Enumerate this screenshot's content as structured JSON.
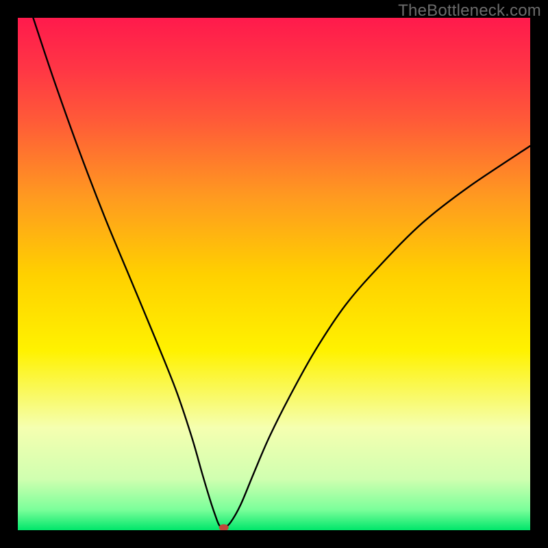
{
  "watermark": "TheBottleneck.com",
  "chart_data": {
    "type": "line",
    "title": "",
    "xlabel": "",
    "ylabel": "",
    "xlim": [
      0,
      100
    ],
    "ylim": [
      0,
      100
    ],
    "background_gradient": {
      "stops": [
        {
          "offset": 0.0,
          "color": "#ff1a4c"
        },
        {
          "offset": 0.1,
          "color": "#ff3645"
        },
        {
          "offset": 0.2,
          "color": "#ff5a38"
        },
        {
          "offset": 0.35,
          "color": "#ff9a20"
        },
        {
          "offset": 0.5,
          "color": "#ffd000"
        },
        {
          "offset": 0.65,
          "color": "#fff200"
        },
        {
          "offset": 0.8,
          "color": "#f5ffb0"
        },
        {
          "offset": 0.9,
          "color": "#d0ffb0"
        },
        {
          "offset": 0.96,
          "color": "#7bff9a"
        },
        {
          "offset": 1.0,
          "color": "#00e66a"
        }
      ]
    },
    "series": [
      {
        "name": "bottleneck-curve",
        "color": "#000000",
        "stroke_width": 2.4,
        "x": [
          3,
          7,
          12,
          17,
          22,
          27,
          31,
          34,
          36,
          37.5,
          38.5,
          39.3,
          40.2,
          41.5,
          43.5,
          46,
          49,
          53,
          58,
          64,
          71,
          79,
          88,
          100
        ],
        "y": [
          100,
          88,
          74,
          61,
          49,
          37,
          27,
          18,
          11,
          6,
          3,
          1,
          0.5,
          1.5,
          5,
          11,
          18,
          26,
          35,
          44,
          52,
          60,
          67,
          75
        ]
      }
    ],
    "marker": {
      "name": "optimal-point",
      "x": 40.2,
      "y": 0.5,
      "color": "#c2473a",
      "rx": 7,
      "ry": 5
    }
  }
}
